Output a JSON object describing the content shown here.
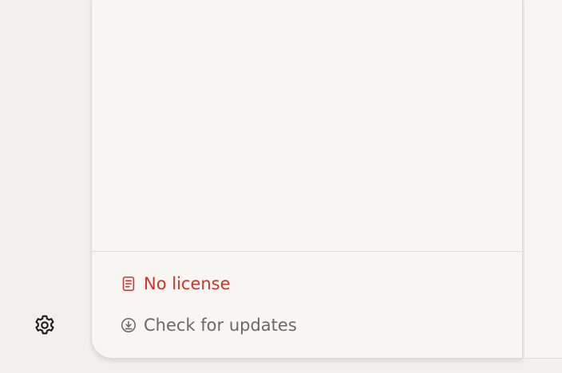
{
  "sidebar": {
    "settings_icon": "gear-icon"
  },
  "footer": {
    "license": {
      "label": "No license",
      "icon": "document-icon",
      "color": "#d0332c"
    },
    "updates": {
      "label": "Check for updates",
      "icon": "download-circle-icon",
      "color": "#6a6966"
    }
  }
}
